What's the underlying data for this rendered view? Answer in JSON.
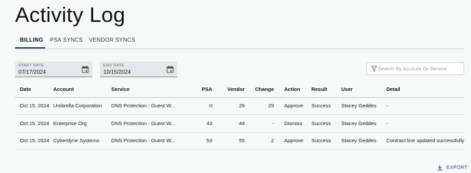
{
  "page": {
    "title": "Activity Log"
  },
  "tabs": [
    {
      "label": "BILLING",
      "active": true
    },
    {
      "label": "PSA SYNCS",
      "active": false
    },
    {
      "label": "VENDOR SYNCS",
      "active": false
    }
  ],
  "filters": {
    "start_date": {
      "label": "START DATE",
      "value": "07/17/2024"
    },
    "end_date": {
      "label": "END DATE",
      "value": "10/15/2024"
    },
    "search": {
      "placeholder": "Search By Account Or Service",
      "value": ""
    }
  },
  "table": {
    "columns": [
      "Date",
      "Account",
      "Service",
      "PSA",
      "Vendor",
      "Change",
      "Action",
      "Result",
      "User",
      "Detail"
    ],
    "rows": [
      {
        "date": "Oct 15, 2024",
        "account": "Umbrella Corporation",
        "service": "DNS Protection - Guest W...",
        "psa": "0",
        "vendor": "29",
        "change": "29",
        "action": "Approve",
        "result": "Success",
        "user": "Stacey Geddes",
        "detail": "-"
      },
      {
        "date": "Oct 15, 2024",
        "account": "Enterprise Org",
        "service": "DNS Protection - Guest W...",
        "psa": "43",
        "vendor": "44",
        "change": "-",
        "action": "Dismiss",
        "result": "Success",
        "user": "Stacey Geddes",
        "detail": "-"
      },
      {
        "date": "Oct 15, 2024",
        "account": "Cyberdyne Systems",
        "service": "DNS Protection - Guest W...",
        "psa": "53",
        "vendor": "55",
        "change": "2",
        "action": "Approve",
        "result": "Success",
        "user": "Stacey Geddes",
        "detail": "Contract line updated successfully"
      }
    ]
  },
  "footer": {
    "export_label": "EXPORT"
  },
  "icons": {
    "calendar": "calendar-icon",
    "filter": "filter-icon",
    "export": "download-icon"
  },
  "colors": {
    "accent": "#2c3ea0",
    "background": "#f7f8f8"
  }
}
